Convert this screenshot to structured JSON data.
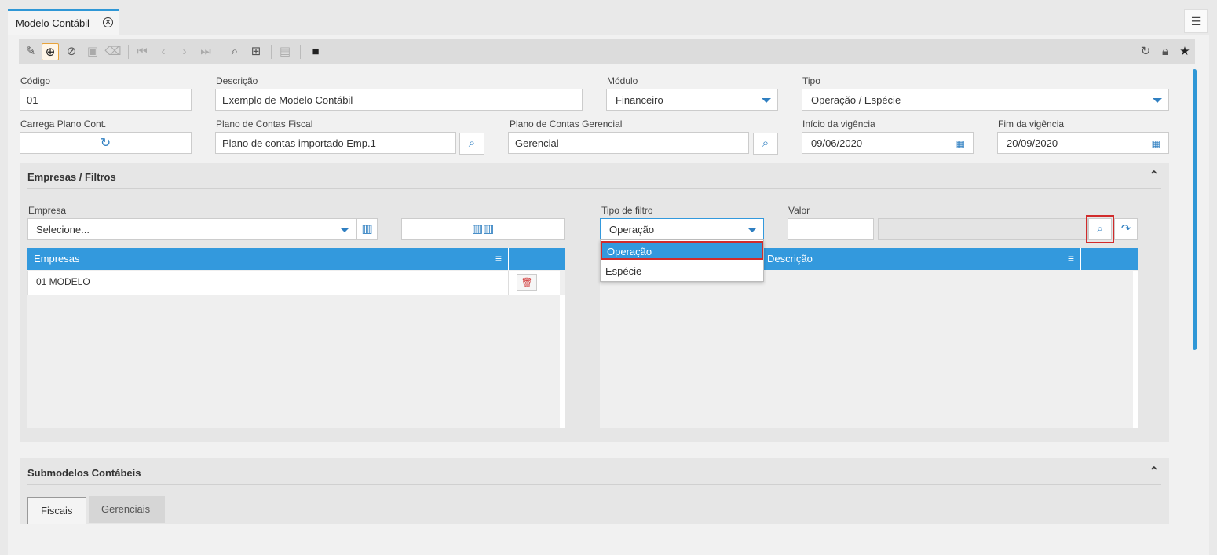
{
  "tab": {
    "title": "Modelo Contábil"
  },
  "icons": {
    "close": "close-circle-icon",
    "top_right": "list-settings-icon"
  },
  "form": {
    "codigo": {
      "label": "Código",
      "value": "01"
    },
    "descricao": {
      "label": "Descrição",
      "value": "Exemplo de Modelo Contábil"
    },
    "modulo": {
      "label": "Módulo",
      "value": "Financeiro"
    },
    "tipo": {
      "label": "Tipo",
      "value": "Operação / Espécie"
    },
    "carrega_plano": {
      "label": "Carrega Plano Cont."
    },
    "plano_fiscal": {
      "label": "Plano de Contas Fiscal",
      "value": "Plano de contas importado Emp.1"
    },
    "plano_gerencial": {
      "label": "Plano de Contas Gerencial",
      "value": "Gerencial"
    },
    "inicio_vigencia": {
      "label": "Início da vigência",
      "value": "09/06/2020"
    },
    "fim_vigencia": {
      "label": "Fim da vigência",
      "value": "20/09/2020"
    }
  },
  "empresas_panel": {
    "title": "Empresas / Filtros",
    "empresa": {
      "label": "Empresa",
      "placeholder": "Selecione..."
    },
    "tipo_filtro": {
      "label": "Tipo de filtro",
      "value": "Operação",
      "options": [
        "Operação",
        "Espécie"
      ]
    },
    "valor": {
      "label": "Valor"
    },
    "grid_left": {
      "header": "Empresas",
      "rows": [
        "01 MODELO"
      ]
    },
    "grid_right": {
      "header": "Descrição"
    }
  },
  "submodelos_panel": {
    "title": "Submodelos Contábeis",
    "tabs": [
      "Fiscais",
      "Gerenciais"
    ]
  },
  "colors": {
    "accent": "#3399dd",
    "highlight": "#d12b2b"
  }
}
